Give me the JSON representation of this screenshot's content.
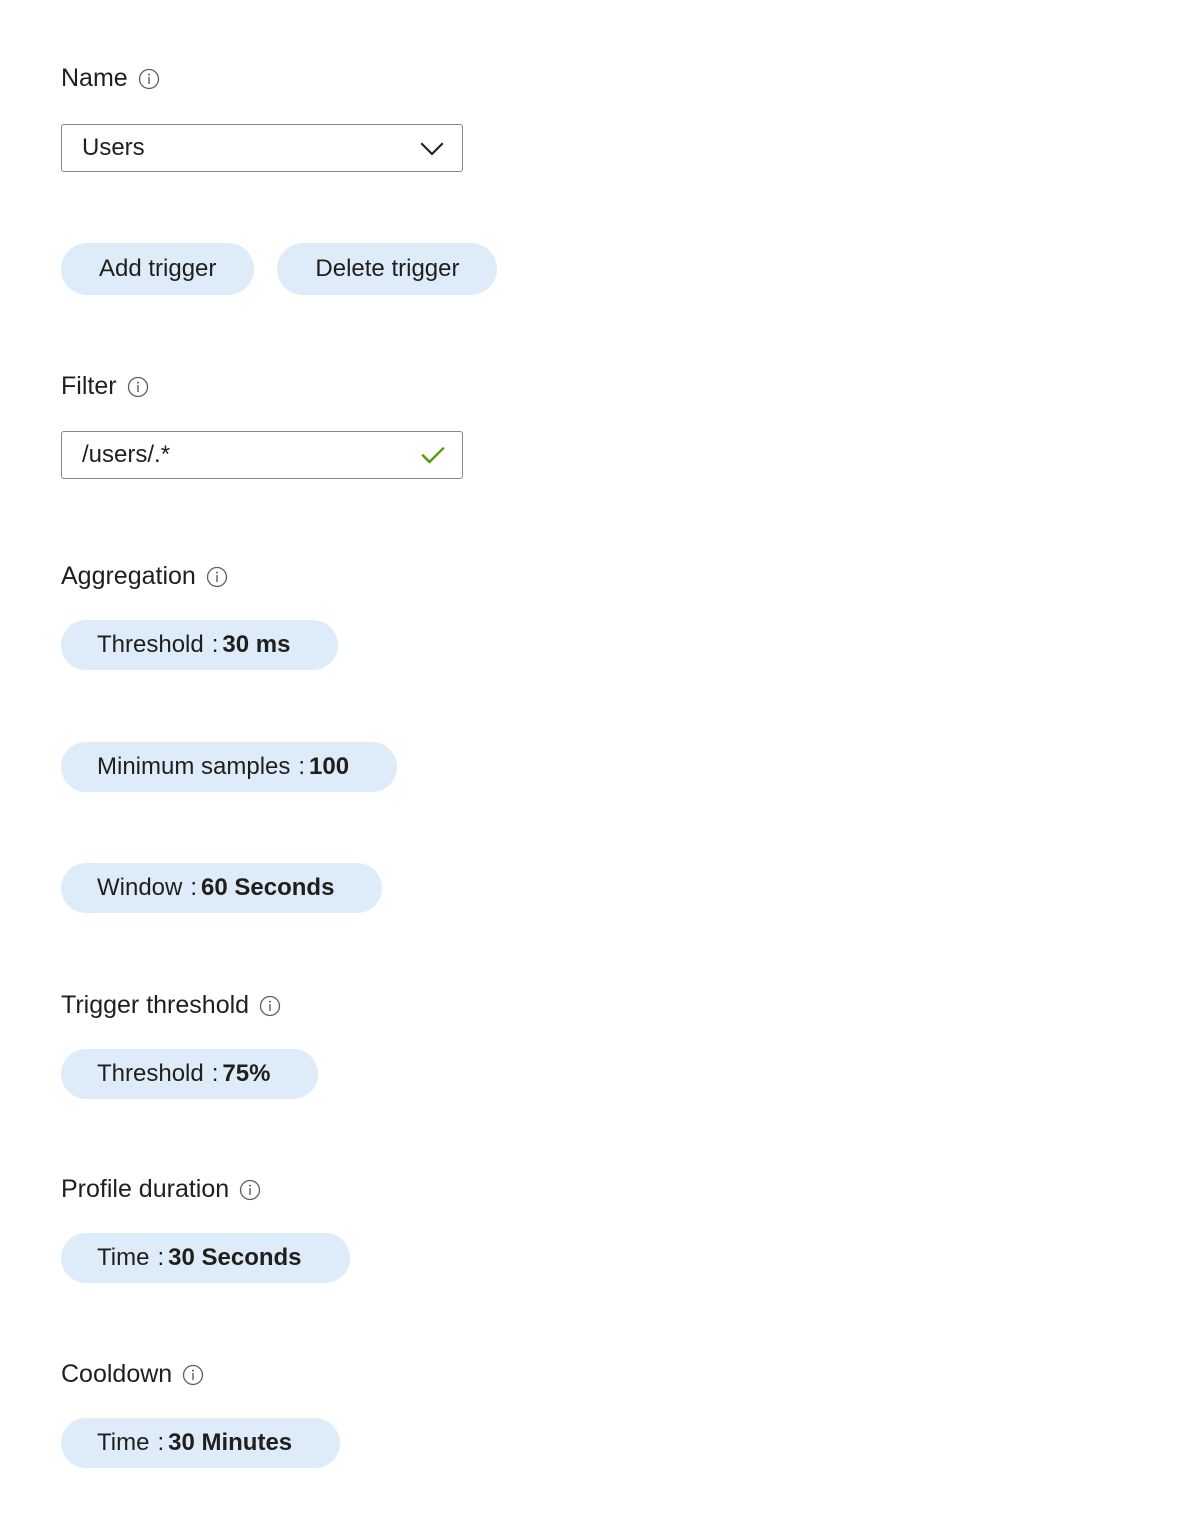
{
  "fields": {
    "name": {
      "label": "Name",
      "info_icon": "info-icon",
      "value": "Users",
      "dropdown_icon": "chevron-down-icon"
    },
    "filter": {
      "label": "Filter",
      "info_icon": "info-icon",
      "value": "/users/.*",
      "validation_icon": "checkmark-icon",
      "validation_color": "#4f9c00"
    },
    "aggregation": {
      "label": "Aggregation",
      "info_icon": "info-icon",
      "pills": [
        {
          "key": "Threshold",
          "sep": ":",
          "value": "30 ms"
        },
        {
          "key": "Minimum samples",
          "sep": ":",
          "value": "100"
        },
        {
          "key": "Window",
          "sep": ":",
          "value": "60 Seconds"
        }
      ]
    },
    "trigger_threshold": {
      "label": "Trigger threshold",
      "info_icon": "info-icon",
      "pills": [
        {
          "key": "Threshold",
          "sep": ":",
          "value": "75%"
        }
      ]
    },
    "profile_duration": {
      "label": "Profile duration",
      "info_icon": "info-icon",
      "pills": [
        {
          "key": "Time",
          "sep": ":",
          "value": "30 Seconds"
        }
      ]
    },
    "cooldown": {
      "label": "Cooldown",
      "info_icon": "info-icon",
      "pills": [
        {
          "key": "Time",
          "sep": ":",
          "value": "30 Minutes"
        }
      ]
    }
  },
  "buttons": {
    "add_trigger": "Add trigger",
    "delete_trigger": "Delete trigger"
  },
  "colors": {
    "pill_background": "#deecf9",
    "text": "#201f1e",
    "border": "#8a8886",
    "success": "#4f9c00"
  }
}
